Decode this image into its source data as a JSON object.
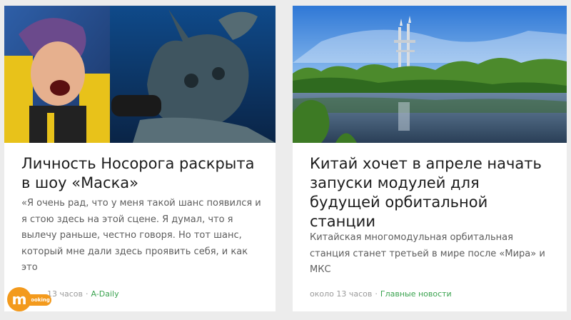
{
  "cards": [
    {
      "title": "Личность Носорога раскрыта в шоу «Маска»",
      "lead": "«Я очень рад, что у меня такой шанс появился и я стою здесь на этой сцене. Я думал, что я вылечу раньше, честно говоря. Но тот шанс, который мне дали здесь проявить себя, и как это",
      "time": "13 часов",
      "source": "A-Daily",
      "image_icon": "rhino-mask-photo"
    },
    {
      "title": "Китай хочет в апреле начать запуски модулей для будущей орбитальной станции",
      "lead": "Китайская многомодульная орбитальная станция станет третьей в мире после «Мира» и МКС",
      "time": "около 13 часов",
      "source": "Главные новости",
      "image_icon": "lake-tower-photo"
    }
  ],
  "logo": {
    "letter": "m",
    "label": "booking",
    "color": "#f39a1d"
  },
  "colors": {
    "source_link": "#3aa34f",
    "background": "#ececec"
  }
}
